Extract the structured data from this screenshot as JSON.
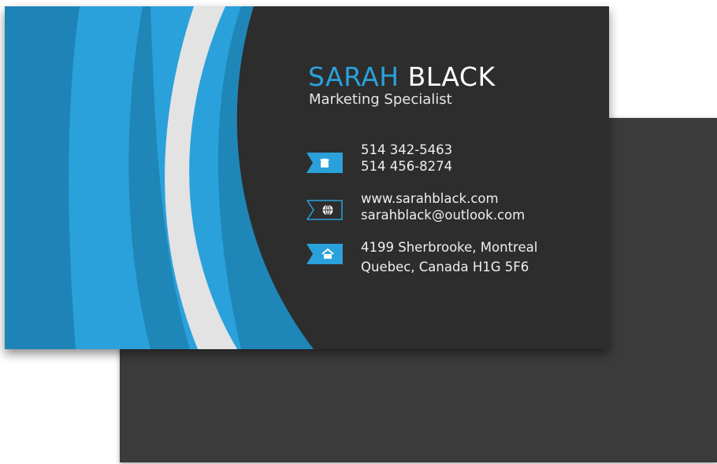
{
  "card": {
    "first_name": "SARAH",
    "last_name": "BLACK",
    "job_title": "Marketing Specialist",
    "phone": {
      "icon": "phone-icon",
      "lines": [
        "514 342-5463",
        "514 456-8274"
      ]
    },
    "web": {
      "icon": "globe-icon",
      "lines": [
        "www.sarahblack.com",
        "sarahblack@outlook.com"
      ]
    },
    "address": {
      "icon": "home-icon",
      "lines": [
        "4199 Sherbrooke, Montreal",
        "Quebec, Canada H1G 5F6"
      ]
    }
  },
  "colors": {
    "accent_blue": "#2aa1db",
    "dark_blue": "#1f86b8",
    "card_dark": "#2d2d2d",
    "back_card": "#3b3b3b",
    "stripe_light": "#e3e3e3"
  }
}
